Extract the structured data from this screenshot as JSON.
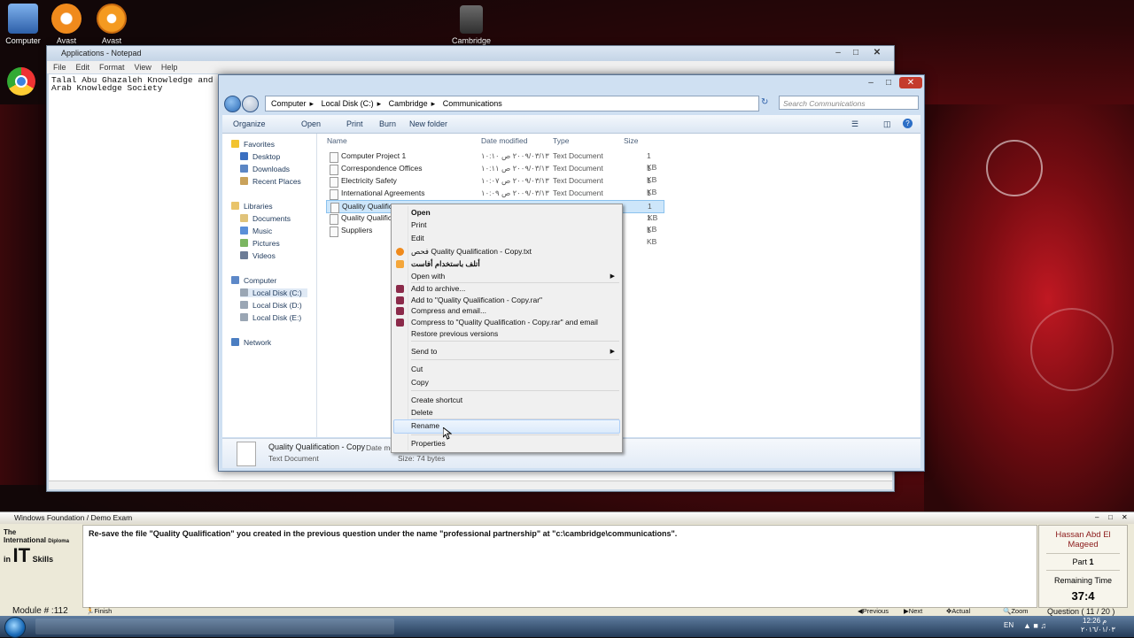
{
  "desktop": {
    "icons": [
      {
        "label": "Computer",
        "color": "#3a73c4"
      },
      {
        "label": "Avast",
        "color": "#f08a1c"
      },
      {
        "label": "Avast",
        "color": "#f49a20"
      },
      {
        "label": "Cambridge",
        "color": "#5b5b5b"
      }
    ]
  },
  "notepad": {
    "title": "Applications - Notepad",
    "menu": [
      "File",
      "Edit",
      "Format",
      "View",
      "Help"
    ],
    "line1": "Talal Abu Ghazaleh Knowledge and Ma",
    "line2": "Arab Knowledge Society"
  },
  "explorer": {
    "breadcrumb": [
      "Computer",
      "Local Disk (C:)",
      "Cambridge",
      "Communications"
    ],
    "search_placeholder": "Search Communications",
    "toolbar": {
      "organize": "Organize",
      "open": "Open",
      "print": "Print",
      "burn": "Burn",
      "new_folder": "New folder"
    },
    "nav": {
      "favorites": "Favorites",
      "desktop": "Desktop",
      "downloads": "Downloads",
      "recent": "Recent Places",
      "libraries": "Libraries",
      "documents": "Documents",
      "music": "Music",
      "pictures": "Pictures",
      "videos": "Videos",
      "computer": "Computer",
      "disk_c": "Local Disk (C:)",
      "disk_d": "Local Disk (D:)",
      "disk_e": "Local Disk (E:)",
      "network": "Network"
    },
    "columns": {
      "name": "Name",
      "date": "Date modified",
      "type": "Type",
      "size": "Size"
    },
    "files": [
      {
        "name": "Computer Project 1",
        "date": "٢٠٠٩/٠٣/١٣ ص ١٠:١٠",
        "type": "Text Document",
        "size": "1 KB"
      },
      {
        "name": "Correspondence Offices",
        "date": "٢٠٠٩/٠٣/١٣ ص ١٠:١١",
        "type": "Text Document",
        "size": "1 KB"
      },
      {
        "name": "Electricity Safety",
        "date": "٢٠٠٩/٠٣/١٣ ص ١٠:٠٧",
        "type": "Text Document",
        "size": "1 KB"
      },
      {
        "name": "International Agreements",
        "date": "٢٠٠٩/٠٣/١٣ ص ١٠:٠٩",
        "type": "Text Document",
        "size": "1 KB"
      },
      {
        "name": "Quality Qualificatio",
        "date": "",
        "type": "",
        "size": "1 KB"
      },
      {
        "name": "Quality Qualificati",
        "date": "",
        "type": "",
        "size": "1 KB"
      },
      {
        "name": "Suppliers",
        "date": "",
        "type": "",
        "size": "1 KB"
      }
    ],
    "details": {
      "name": "Quality Qualification - Copy",
      "type": "Text Document",
      "date_label": "Date mo",
      "size": "Size: 74 bytes"
    }
  },
  "context_menu": {
    "open": "Open",
    "print": "Print",
    "edit": "Edit",
    "scan": "Quality Qualification - Copy.txt",
    "scan_prefix": "فحص",
    "shred": "أتلف باستخدام أفاست",
    "open_with": "Open with",
    "add_archive": "Add to archive...",
    "add_rar": "Add to \"Quality Qualification - Copy.rar\"",
    "compress_email": "Compress and email...",
    "compress_rar_email": "Compress to \"Quality Qualification - Copy.rar\" and email",
    "restore": "Restore previous versions",
    "send_to": "Send to",
    "cut": "Cut",
    "copy": "Copy",
    "create_shortcut": "Create shortcut",
    "delete": "Delete",
    "rename": "Rename",
    "properties": "Properties"
  },
  "exam": {
    "title": "Windows Foundation / Demo Exam",
    "question": "Re-save the file \"Quality Qualification\" you created in the previous question under the name \"professional partnership\" at \"c:\\cambridge\\communications\".",
    "logo": {
      "the": "The",
      "international": "International",
      "diploma": "Diploma",
      "in": "in",
      "it": "IT",
      "skills": "Skills"
    },
    "user": "Hassan Abd El Mageed",
    "part_label": "Part",
    "part": "1",
    "remaining_label": "Remaining Time",
    "time": "37:4",
    "module": "Module # :112",
    "finish": "Finish Demo Exam",
    "previous": "Previous",
    "next": "Next",
    "actual_size": "Actual Size",
    "zoom": "Zoom",
    "question_counter": "Question ( 11 / 20 )"
  },
  "taskbar": {
    "lang": "EN",
    "time": "12:26 م",
    "date": "٢٠١٦/٠١/٠٣"
  }
}
